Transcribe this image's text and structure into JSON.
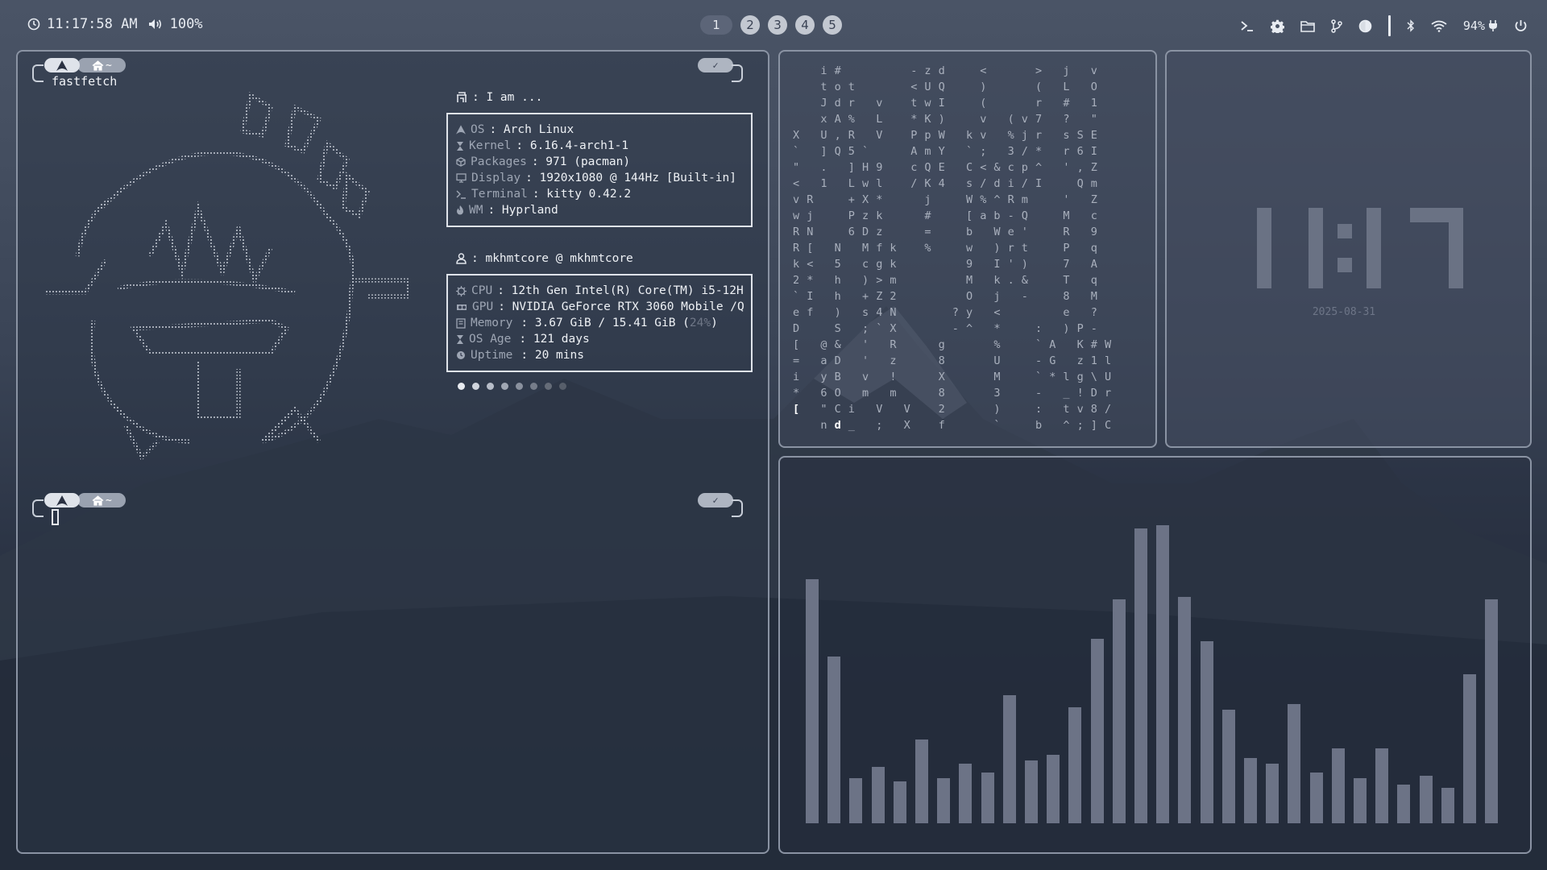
{
  "topbar": {
    "time": "11:17:58 AM",
    "volume": "100%",
    "workspaces": [
      "1",
      "2",
      "3",
      "4",
      "5"
    ],
    "active_workspace": "1",
    "battery": "94%",
    "icons": [
      "terminal-icon",
      "gear-icon",
      "folder-icon",
      "git-branch-icon",
      "half-circle-icon",
      "bluetooth-icon",
      "wifi-icon",
      "battery-charging-icon",
      "power-icon"
    ]
  },
  "terminal": {
    "prompt_home": "~",
    "prompt_ok": "✓",
    "command": "fastfetch",
    "fastfetch": {
      "header1": ": I am ...",
      "os_label": "OS",
      "os_value": ": Arch Linux",
      "kernel_label": "Kernel",
      "kernel_value": ": 6.16.4-arch1-1",
      "packages_label": "Packages",
      "packages_value": ": 971 (pacman)",
      "display_label": "Display",
      "display_value": ": 1920x1080 @ 144Hz [Built-in]",
      "terminal_label": "Terminal",
      "terminal_value": ": kitty 0.42.2",
      "wm_label": "WM",
      "wm_value": ": Hyprland",
      "header2": ": mkhmtcore @ mkhmtcore",
      "cpu_label": "CPU",
      "cpu_value": ": 12th Gen Intel(R) Core(TM) i5-12H",
      "gpu_label": "GPU",
      "gpu_value": ": NVIDIA GeForce RTX 3060 Mobile /Q",
      "memory_label": "Memory",
      "memory_value": ": 3.67 GiB / 15.41 GiB (",
      "memory_pct": "24%",
      "memory_close": ")",
      "osage_label": "OS Age",
      "osage_value": ": 121 days",
      "uptime_label": "Uptime",
      "uptime_value": ": 20 mins",
      "palette": [
        "#e8ebf0",
        "#d0d5dd",
        "#b7bdc8",
        "#a0a7b3",
        "#8a919e",
        "#767d8a",
        "#656c78",
        "#575e6a"
      ]
    }
  },
  "clock": {
    "time": "11:17",
    "date": "2025-08-31"
  },
  "matrix": {
    "columns": [
      {
        "col": 0,
        "chars": [
          [
            5,
            "X"
          ],
          [
            6,
            "`"
          ],
          [
            7,
            "\""
          ],
          [
            8,
            "<"
          ],
          [
            9,
            "v R"
          ],
          [
            10,
            "w j"
          ],
          [
            11,
            "R N"
          ],
          [
            12,
            "R ["
          ],
          [
            13,
            "k <"
          ],
          [
            14,
            "2 *"
          ],
          [
            15,
            "` I"
          ],
          [
            16,
            "e f"
          ],
          [
            17,
            "D"
          ],
          [
            18,
            "["
          ],
          [
            19,
            "="
          ],
          [
            20,
            "i"
          ],
          [
            21,
            "*"
          ],
          [
            22,
            "["
          ]
        ]
      }
    ],
    "rows": [
      "    i #          - z d     <       >   j   v",
      "    t o t        < U Q     )       (   L   O",
      "    J d r   v    t w I     (       r   #   1",
      "    x A %   L    * K )     v   ( v 7   ?   \"",
      "X   U , R   V    P p W   k v   % j r   s S E",
      "`   ] Q 5 `      A m Y   ` ;   3 / *   r 6 I",
      "\"   .   ] H 9    c Q E   C < & c p ^   ' , Z",
      "<   1   L w l    / K 4   s / d i / I     Q m",
      "v R     + X *      j     W % ^ R m     '   Z",
      "w j     P z k      #     [ a b - Q     M   c",
      "R N     6 D z      =     b   W e '     R   9",
      "R [   N   M f k    %     w   ) r t     P   q",
      "k <   5   c g k          9   I ' )     7   A",
      "2 *   h   ) > m          M   k . &     T   q",
      "` I   h   + Z 2          O   j   -     8   M",
      "e f   )   s 4 N        ? y   <         e   ?",
      "D     S   ; ` X        - ^   *     :   ) P -",
      "[   @ &   '   R      g       %     ` A   K # W",
      "=   a D   '   z      8       U     - G   z 1 l",
      "i   y B   v   !      X       M     ` * l g \\ U",
      "*   6 O   m   m      8       3     -   _ ! D r",
      "[   \" C i   V   V    2       )     :   t v 8 /",
      "    n d _   ;   X    f       `     b   ^ ; ] C"
    ]
  },
  "visualizer": {
    "levels": [
      0.82,
      0.56,
      0.15,
      0.19,
      0.14,
      0.28,
      0.15,
      0.2,
      0.17,
      0.43,
      0.21,
      0.23,
      0.39,
      0.62,
      0.75,
      0.99,
      1.0,
      0.76,
      0.61,
      0.38,
      0.22,
      0.2,
      0.4,
      0.17,
      0.25,
      0.15,
      0.25,
      0.13,
      0.16,
      0.12,
      0.5,
      0.75
    ]
  },
  "colors": {
    "accent_panel_border": "#8a93a3",
    "bar": "#6c7386",
    "memory_pct": "#9aa1ad"
  }
}
